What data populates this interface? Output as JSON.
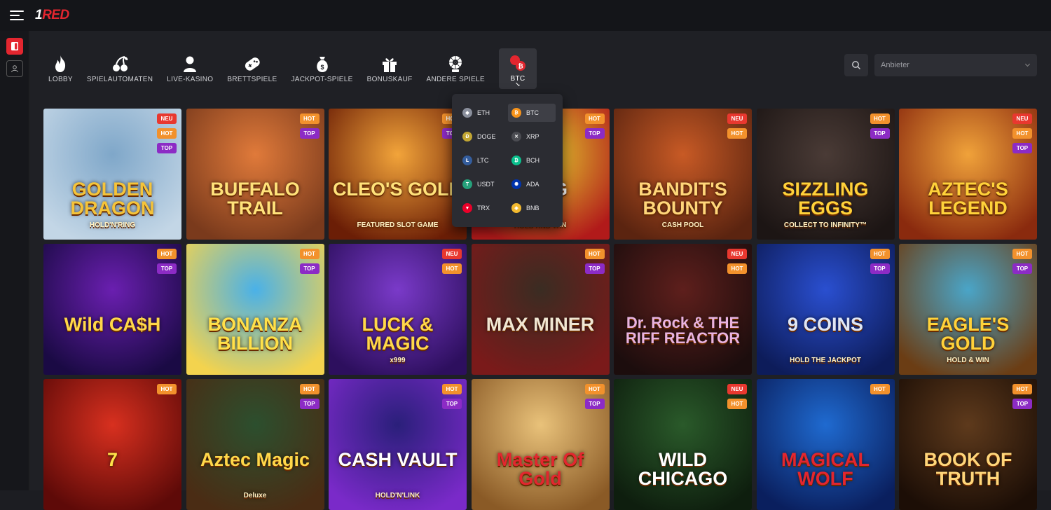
{
  "header": {
    "logo_prefix": "1",
    "logo_suffix": "RED"
  },
  "categories": [
    {
      "key": "lobby",
      "label": "LOBBY",
      "icon": "flame-icon"
    },
    {
      "key": "slots",
      "label": "SPIELAUTOMATEN",
      "icon": "cherries-icon"
    },
    {
      "key": "live",
      "label": "LIVE-KASINO",
      "icon": "dealer-icon"
    },
    {
      "key": "board",
      "label": "BRETTSPIELE",
      "icon": "gamepad-icon"
    },
    {
      "key": "jackpot",
      "label": "JACKPOT-SPIELE",
      "icon": "moneybag-icon"
    },
    {
      "key": "bonus",
      "label": "BONUSKAUF",
      "icon": "gift-icon"
    },
    {
      "key": "other",
      "label": "ANDERE SPIELE",
      "icon": "roulette-icon"
    },
    {
      "key": "btc",
      "label": "BTC",
      "icon": "btc-icon"
    }
  ],
  "provider": {
    "placeholder": "Anbieter"
  },
  "currency_menu": {
    "items": [
      {
        "code": "ETH",
        "color": "#8a8f9c",
        "glyph": "◆"
      },
      {
        "code": "BTC",
        "color": "#f7931a",
        "glyph": "₿",
        "active": true
      },
      {
        "code": "DOGE",
        "color": "#c2a633",
        "glyph": "Ð"
      },
      {
        "code": "XRP",
        "color": "#4b4c52",
        "glyph": "✕"
      },
      {
        "code": "LTC",
        "color": "#345d9d",
        "glyph": "Ł"
      },
      {
        "code": "BCH",
        "color": "#0ac18e",
        "glyph": "₿"
      },
      {
        "code": "USDT",
        "color": "#26a17b",
        "glyph": "T"
      },
      {
        "code": "ADA",
        "color": "#0033ad",
        "glyph": "✺"
      },
      {
        "code": "TRX",
        "color": "#eb0029",
        "glyph": "▼"
      },
      {
        "code": "BNB",
        "color": "#f3ba2f",
        "glyph": "◈"
      }
    ]
  },
  "games": [
    {
      "title": "GOLDEN DRAGON",
      "subtitle": "HOLD'N'RING",
      "badges": [
        "NEU",
        "HOT",
        "TOP"
      ],
      "bg": [
        "#7fa7c9",
        "#c3d6e6"
      ],
      "tc": "#f5c43a"
    },
    {
      "title": "BUFFALO TRAIL",
      "subtitle": "",
      "badges": [
        "HOT",
        "TOP"
      ],
      "bg": [
        "#e07a3a",
        "#7a3a1c"
      ],
      "tc": "#ffe27a"
    },
    {
      "title": "CLEO'S GOLD",
      "subtitle": "FEATURED SLOT GAME",
      "badges": [
        "HOT",
        "TOP"
      ],
      "bg": [
        "#f2a43a",
        "#6b1e06"
      ],
      "tc": "#ffe27a"
    },
    {
      "title": "FROG",
      "subtitle": "HOLD AND WIN",
      "badges": [
        "HOT",
        "TOP"
      ],
      "bg": [
        "#e4d12f",
        "#b11a1a"
      ],
      "tc": "#ffffff"
    },
    {
      "title": "BANDIT'S BOUNTY",
      "subtitle": "CASH POOL",
      "badges": [
        "NEU",
        "HOT"
      ],
      "bg": [
        "#c85a25",
        "#5b2410"
      ],
      "tc": "#ffd67a"
    },
    {
      "title": "SIZZLING EGGS",
      "subtitle": "COLLECT TO INFINITY™",
      "badges": [
        "HOT",
        "TOP"
      ],
      "bg": [
        "#4a3b36",
        "#1c1514"
      ],
      "tc": "#ffd23a"
    },
    {
      "title": "AZTEC'S LEGEND",
      "subtitle": "",
      "badges": [
        "NEU",
        "HOT",
        "TOP"
      ],
      "bg": [
        "#f0a23a",
        "#8a2a0e"
      ],
      "tc": "#ffd23a"
    },
    {
      "title": "Wild CA$H",
      "subtitle": "",
      "badges": [
        "HOT",
        "TOP"
      ],
      "bg": [
        "#6a1fb0",
        "#1a0a44"
      ],
      "tc": "#ffd84a"
    },
    {
      "title": "BONANZA BILLION",
      "subtitle": "",
      "badges": [
        "HOT",
        "TOP"
      ],
      "bg": [
        "#4ab1e8",
        "#f3d34e"
      ],
      "tc": "#ffe14a"
    },
    {
      "title": "LUCK & MAGIC",
      "subtitle": "x999",
      "badges": [
        "NEU",
        "HOT"
      ],
      "bg": [
        "#7a3ac9",
        "#2d0f5e"
      ],
      "tc": "#ffd84a"
    },
    {
      "title": "MAX MINER",
      "subtitle": "",
      "badges": [
        "HOT",
        "TOP"
      ],
      "bg": [
        "#3a2c22",
        "#7a1a1a"
      ],
      "tc": "#f0e6d2"
    },
    {
      "title": "Dr. Rock & THE RIFF REACTOR",
      "subtitle": "",
      "badges": [
        "NEU",
        "HOT"
      ],
      "bg": [
        "#5e1f1c",
        "#1c0d0d"
      ],
      "tc": "#e8b3e0"
    },
    {
      "title": "9 COINS",
      "subtitle": "HOLD THE JACKPOT",
      "badges": [
        "HOT",
        "TOP"
      ],
      "bg": [
        "#2a4fd0",
        "#0d1c5a"
      ],
      "tc": "#dfe6f5"
    },
    {
      "title": "EAGLE'S GOLD",
      "subtitle": "HOLD & WIN",
      "badges": [
        "HOT",
        "TOP"
      ],
      "bg": [
        "#4aa5c8",
        "#6b3d14"
      ],
      "tc": "#ffd23a"
    },
    {
      "title": "7",
      "subtitle": "",
      "badges": [
        "HOT"
      ],
      "bg": [
        "#d8301f",
        "#5e0a08"
      ],
      "tc": "#ffe14a"
    },
    {
      "title": "Aztec Magic",
      "subtitle": "Deluxe",
      "badges": [
        "HOT",
        "TOP"
      ],
      "bg": [
        "#2c4f2e",
        "#4a2c14"
      ],
      "tc": "#ffd84a"
    },
    {
      "title": "CASH VAULT",
      "subtitle": "HOLD'N'LINK",
      "badges": [
        "HOT",
        "TOP"
      ],
      "bg": [
        "#2a1f7a",
        "#7a2ac9"
      ],
      "tc": "#ffffff"
    },
    {
      "title": "Master Of Gold",
      "subtitle": "",
      "badges": [
        "HOT",
        "TOP"
      ],
      "bg": [
        "#e9c27a",
        "#8a5a26"
      ],
      "tc": "#e3262f"
    },
    {
      "title": "WILD CHICAGO",
      "subtitle": "",
      "badges": [
        "NEU",
        "HOT"
      ],
      "bg": [
        "#2a5a2a",
        "#0e1e0e"
      ],
      "tc": "#ffffff"
    },
    {
      "title": "MAGICAL WOLF",
      "subtitle": "",
      "badges": [
        "HOT"
      ],
      "bg": [
        "#1f6ad0",
        "#0a1f5e"
      ],
      "tc": "#e3262f"
    },
    {
      "title": "BOOK OF TRUTH",
      "subtitle": "",
      "badges": [
        "HOT",
        "TOP"
      ],
      "bg": [
        "#5e3a1c",
        "#1c0e06"
      ],
      "tc": "#ffd67a"
    }
  ]
}
